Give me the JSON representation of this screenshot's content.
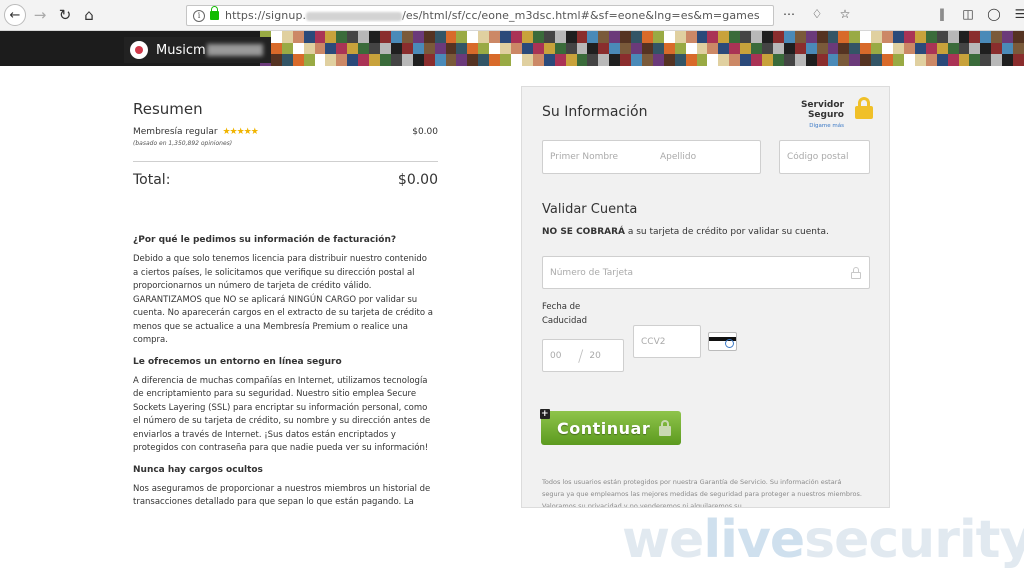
{
  "browser": {
    "url_prefix": "https://signup.",
    "url_suffix": "/es/html/sf/cc/eone_m3dsc.html#&sf=eone&lng=es&m=games",
    "icons": {
      "back": "back-arrow-icon",
      "forward": "forward-arrow-icon",
      "reload": "reload-icon",
      "home": "home-icon",
      "info": "info-icon",
      "lock": "lock-icon",
      "more": "more-dots-icon",
      "pocket": "pocket-icon",
      "bookmark": "star-icon",
      "library": "library-icon",
      "sidebar": "sidebar-icon",
      "account": "account-icon",
      "menu": "hamburger-menu-icon"
    }
  },
  "header": {
    "brand": "Musicm"
  },
  "summary": {
    "title": "Resumen",
    "membership_label": "Membresía regular",
    "stars": "★★★★★",
    "membership_price": "$0.00",
    "opinions_note": "(basado en 1,350,892 opiniones)",
    "total_label": "Total:",
    "total_value": "$0.00"
  },
  "faq": [
    {
      "question": "¿Por qué le pedimos su información de facturación?",
      "answer": "Debido a que solo tenemos licencia para distribuir nuestro contenido a ciertos países, le solicitamos que verifique su dirección postal al proporcionarnos un número de tarjeta de crédito válido. GARANTIZAMOS que NO se aplicará NINGÚN CARGO por validar su cuenta. No aparecerán cargos en el extracto de su tarjeta de crédito a menos que se actualice a una Membresía Premium o realice una compra."
    },
    {
      "question": "Le ofrecemos un entorno en línea seguro",
      "answer": "A diferencia de muchas compañías en Internet, utilizamos tecnología de encriptamiento para su seguridad. Nuestro sitio emplea Secure Sockets Layering (SSL) para encriptar su información personal, como el número de su tarjeta de crédito, su nombre y su dirección antes de enviarlos a través de Internet. ¡Sus datos están encriptados y protegidos con contraseña para que nadie pueda ver su información!"
    },
    {
      "question": "Nunca hay cargos ocultos",
      "answer": "Nos aseguramos de proporcionar a nuestros miembros un historial de transacciones detallado para que sepan lo que están pagando. La"
    }
  ],
  "form": {
    "info_title": "Su Información",
    "secure_label": "Servidor Seguro",
    "secure_link": "Dígame más",
    "first_name_placeholder": "Primer Nombre",
    "last_name_placeholder": "Apellido",
    "postal_placeholder": "Código postal",
    "validate_title": "Validar Cuenta",
    "no_charge_bold": "NO SE COBRARÁ",
    "no_charge_rest": " a su tarjeta de crédito por validar su cuenta.",
    "card_number_placeholder": "Número de Tarjeta",
    "expiry_label_line1": "Fecha de",
    "expiry_label_line2": "Caducidad",
    "month_placeholder": "00",
    "year_placeholder": "20",
    "cvv_placeholder": "CCV2",
    "continue_label": "Continuar",
    "legal_text": "Todos los usuarios están protegidos por nuestra Garantía de Servicio. Su información estará segura ya que empleamos las mejores medidas de seguridad para proteger a nuestros miembros. Valoramos su privacidad y no venderemos ni alquilaremos su"
  },
  "watermark": {
    "part1": "we",
    "part2": "live",
    "part3": "security"
  },
  "colors": {
    "button_green": "#6fae2e",
    "padlock_yellow": "#f0c028",
    "star_gold": "#f0b400",
    "link_blue": "#3b79c6"
  }
}
